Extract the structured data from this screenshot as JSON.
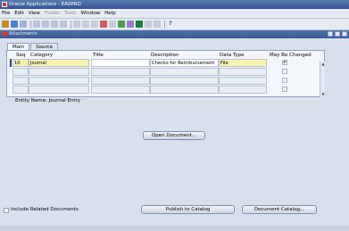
{
  "window": {
    "title": "Oracle Applications - EASPRD"
  },
  "menu": [
    {
      "label": "File",
      "disabled": false
    },
    {
      "label": "Edit",
      "disabled": false
    },
    {
      "label": "View",
      "disabled": false
    },
    {
      "label": "Folder",
      "disabled": true
    },
    {
      "label": "Tools",
      "disabled": true
    },
    {
      "label": "Window",
      "disabled": false
    },
    {
      "label": "Help",
      "disabled": false
    }
  ],
  "form": {
    "title": "Attachments"
  },
  "tabs": [
    {
      "label": "Main",
      "active": true
    },
    {
      "label": "Source",
      "active": false
    }
  ],
  "grid": {
    "headers": {
      "seq": "Seq",
      "category": "Category",
      "title": "Title",
      "description": "Description",
      "data_type": "Data Type",
      "may_be_changed": "May Be Changed"
    },
    "rows": [
      {
        "seq": "10",
        "category": "Journal",
        "title": "",
        "description": "Checks for Reimbursement",
        "data_type": "File",
        "may_be_changed": true
      },
      {
        "seq": "",
        "category": "",
        "title": "",
        "description": "",
        "data_type": "",
        "may_be_changed": false
      },
      {
        "seq": "",
        "category": "",
        "title": "",
        "description": "",
        "data_type": "",
        "may_be_changed": false
      },
      {
        "seq": "",
        "category": "",
        "title": "",
        "description": "",
        "data_type": "",
        "may_be_changed": false
      }
    ]
  },
  "entity": {
    "label": "Entity Name: Journal Entry"
  },
  "buttons": {
    "open_document": "Open Document...",
    "publish": "Publish to Catalog",
    "document_catalog": "Document Catalog..."
  },
  "include_related": {
    "label": "Include Related Documents",
    "checked": false
  },
  "colors": {
    "title_bar": "#2f5595",
    "required_field": "#fbf2b0",
    "panel": "#d8e0ec"
  }
}
